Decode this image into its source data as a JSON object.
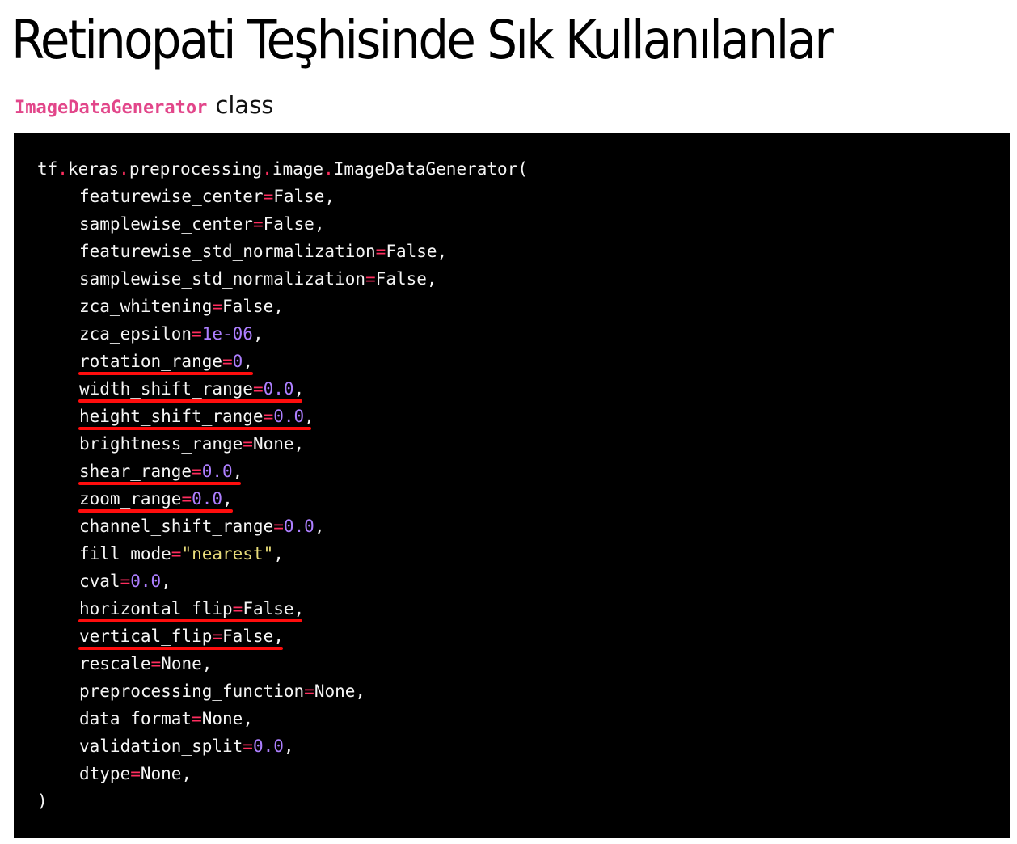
{
  "page": {
    "title": "Retinopati Teşhisinde Sık Kullanılanlar",
    "subtitle_class_name": "ImageDataGenerator",
    "subtitle_word": "class"
  },
  "code": {
    "call_parts": [
      "tf",
      ".",
      "keras",
      ".",
      "preprocessing",
      ".",
      "image",
      ".",
      "ImageDataGenerator("
    ],
    "params": [
      {
        "name": "featurewise_center",
        "eq": "=",
        "value": "False",
        "value_type": "keyword",
        "sep": ",",
        "highlighted": false
      },
      {
        "name": "samplewise_center",
        "eq": "=",
        "value": "False",
        "value_type": "keyword",
        "sep": ",",
        "highlighted": false
      },
      {
        "name": "featurewise_std_normalization",
        "eq": "=",
        "value": "False",
        "value_type": "keyword",
        "sep": ",",
        "highlighted": false
      },
      {
        "name": "samplewise_std_normalization",
        "eq": "=",
        "value": "False",
        "value_type": "keyword",
        "sep": ",",
        "highlighted": false
      },
      {
        "name": "zca_whitening",
        "eq": "=",
        "value": "False",
        "value_type": "keyword",
        "sep": ",",
        "highlighted": false
      },
      {
        "name": "zca_epsilon",
        "eq": "=",
        "value": "1e-06",
        "value_type": "number",
        "sep": ",",
        "highlighted": false
      },
      {
        "name": "rotation_range",
        "eq": "=",
        "value": "0",
        "value_type": "number",
        "sep": ",",
        "highlighted": true
      },
      {
        "name": "width_shift_range",
        "eq": "=",
        "value": "0.0",
        "value_type": "number",
        "sep": ",",
        "highlighted": true
      },
      {
        "name": "height_shift_range",
        "eq": "=",
        "value": "0.0",
        "value_type": "number",
        "sep": ",",
        "highlighted": true
      },
      {
        "name": "brightness_range",
        "eq": "=",
        "value": "None",
        "value_type": "keyword",
        "sep": ",",
        "highlighted": false
      },
      {
        "name": "shear_range",
        "eq": "=",
        "value": "0.0",
        "value_type": "number",
        "sep": ",",
        "highlighted": true
      },
      {
        "name": "zoom_range",
        "eq": "=",
        "value": "0.0",
        "value_type": "number",
        "sep": ",",
        "highlighted": true
      },
      {
        "name": "channel_shift_range",
        "eq": "=",
        "value": "0.0",
        "value_type": "number",
        "sep": ",",
        "highlighted": false
      },
      {
        "name": "fill_mode",
        "eq": "=",
        "value": "\"nearest\"",
        "value_type": "string",
        "sep": ",",
        "highlighted": false
      },
      {
        "name": "cval",
        "eq": "=",
        "value": "0.0",
        "value_type": "number",
        "sep": ",",
        "highlighted": false
      },
      {
        "name": "horizontal_flip",
        "eq": "=",
        "value": "False",
        "value_type": "keyword",
        "sep": ",",
        "highlighted": true
      },
      {
        "name": "vertical_flip",
        "eq": "=",
        "value": "False",
        "value_type": "keyword",
        "sep": ",",
        "highlighted": true
      },
      {
        "name": "rescale",
        "eq": "=",
        "value": "None",
        "value_type": "keyword",
        "sep": ",",
        "highlighted": false
      },
      {
        "name": "preprocessing_function",
        "eq": "=",
        "value": "None",
        "value_type": "keyword",
        "sep": ",",
        "highlighted": false
      },
      {
        "name": "data_format",
        "eq": "=",
        "value": "None",
        "value_type": "keyword",
        "sep": ",",
        "highlighted": false
      },
      {
        "name": "validation_split",
        "eq": "=",
        "value": "0.0",
        "value_type": "number",
        "sep": ",",
        "highlighted": false
      },
      {
        "name": "dtype",
        "eq": "=",
        "value": "None",
        "value_type": "keyword",
        "sep": ",",
        "highlighted": false
      }
    ],
    "closing": ")"
  },
  "colors": {
    "code_background": "#000000",
    "code_text": "#f5f5f5",
    "operator": "#ff2e5f",
    "number": "#ad7fff",
    "string": "#e8dc7a",
    "highlight_underline": "#ff0d0d",
    "class_name": "#e2468a"
  }
}
